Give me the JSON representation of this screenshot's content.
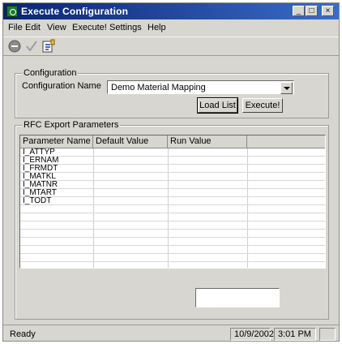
{
  "window": {
    "title": "Execute Configuration"
  },
  "menu": [
    "File",
    "Edit",
    "View",
    "Execute!",
    "Settings",
    "Help"
  ],
  "toolbar": {
    "icons": [
      "stop-icon",
      "check-icon",
      "execute-icon"
    ]
  },
  "configuration": {
    "group_label": "Configuration",
    "name_label": "Configuration Name",
    "name_value": "Demo Material Mapping",
    "load_list_label": "Load List",
    "execute_label": "Execute!"
  },
  "rfc": {
    "group_label": "RFC Export Parameters",
    "columns": [
      "Parameter Name",
      "Default Value",
      "Run Value"
    ],
    "rows": [
      {
        "name": "I_ATTYP",
        "default": "",
        "run": ""
      },
      {
        "name": "I_ERNAM",
        "default": "",
        "run": ""
      },
      {
        "name": "I_FRMDT",
        "default": "",
        "run": ""
      },
      {
        "name": "I_MATKL",
        "default": "",
        "run": ""
      },
      {
        "name": "I_MATNR",
        "default": "",
        "run": ""
      },
      {
        "name": "I_MTART",
        "default": "",
        "run": ""
      },
      {
        "name": "I_TODT",
        "default": "",
        "run": ""
      }
    ]
  },
  "status": {
    "text": "Ready",
    "date": "10/9/2002",
    "time": "3:01 PM"
  }
}
